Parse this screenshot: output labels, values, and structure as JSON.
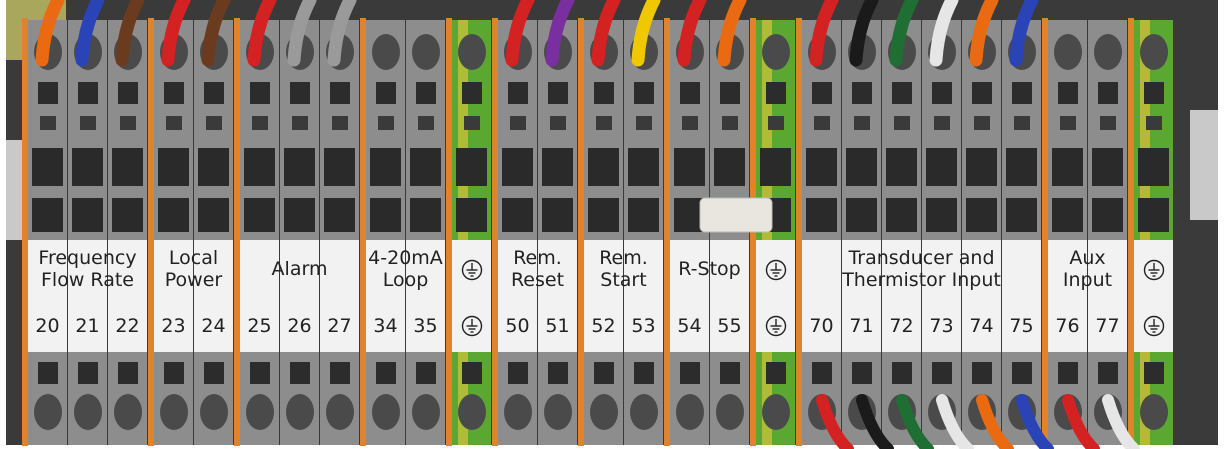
{
  "groups": [
    {
      "name_lines": [
        "Frequency",
        "Flow Rate"
      ],
      "terminals": [
        "20",
        "21",
        "22"
      ]
    },
    {
      "name_lines": [
        "Local",
        "Power"
      ],
      "terminals": [
        "23",
        "24"
      ]
    },
    {
      "name_lines": [
        "Alarm"
      ],
      "terminals": [
        "25",
        "26",
        "27"
      ]
    },
    {
      "name_lines": [
        "4-20mA",
        "Loop"
      ],
      "terminals": [
        "34",
        "35"
      ]
    },
    {
      "name_lines": [],
      "terminals": [],
      "ground": true
    },
    {
      "name_lines": [
        "Rem.",
        "Reset"
      ],
      "terminals": [
        "50",
        "51"
      ]
    },
    {
      "name_lines": [
        "Rem.",
        "Start"
      ],
      "terminals": [
        "52",
        "53"
      ]
    },
    {
      "name_lines": [
        "R-Stop"
      ],
      "terminals": [
        "54",
        "55"
      ]
    },
    {
      "name_lines": [],
      "terminals": [],
      "ground": true
    },
    {
      "name_lines": [
        "Transducer and",
        "Thermistor Input"
      ],
      "terminals": [
        "70",
        "71",
        "72",
        "73",
        "74",
        "75"
      ]
    },
    {
      "name_lines": [
        "Aux",
        "Input"
      ],
      "terminals": [
        "76",
        "77"
      ]
    },
    {
      "name_lines": [],
      "terminals": [],
      "ground": true
    }
  ],
  "colors": {
    "terminal_gray": "#8d8d8d",
    "bridge_orange": "#e0832a",
    "ground_green": "#5aa832",
    "ground_yellow": "#d8c23a",
    "label_white": "#f2f2f2",
    "wire_red": "#d42121",
    "wire_blue": "#2a44b8",
    "wire_brown": "#6b3b1f",
    "wire_orange": "#ea6a12",
    "wire_purple": "#7a2fa0",
    "wire_yellow": "#f0c800",
    "wire_black": "#1a1a1a",
    "wire_green": "#1f6e34",
    "wire_white": "#e6e6e6",
    "wire_gray": "#9a9a9a"
  }
}
